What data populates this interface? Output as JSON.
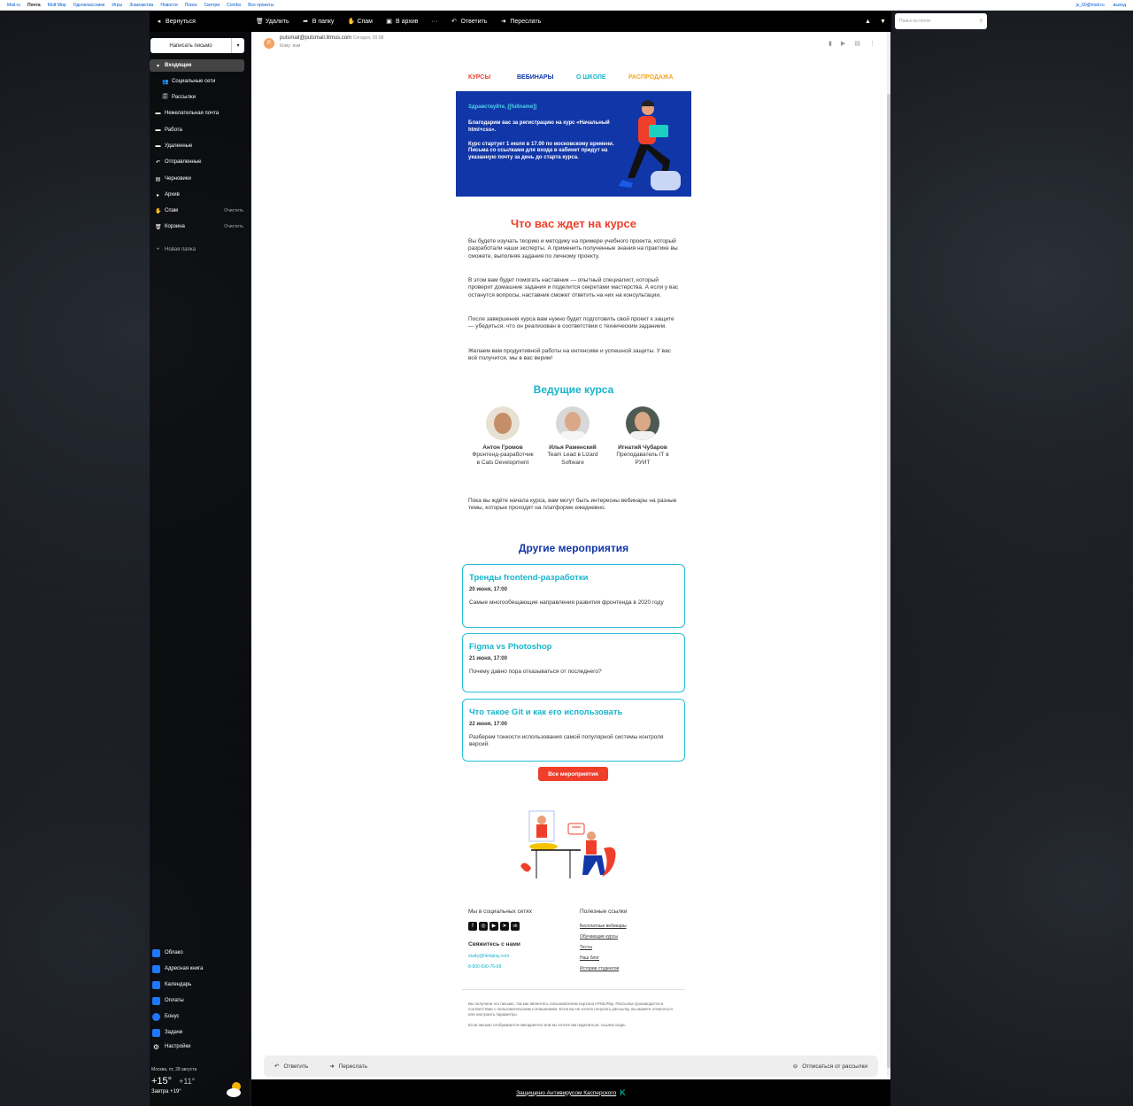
{
  "portal": {
    "links": [
      "Mail.ru",
      "Почта",
      "Мой Мир",
      "Одноклассники",
      "Игры",
      "Знакомства",
      "Новости",
      "Поиск",
      "Смотри",
      "Combo",
      "Все проекты"
    ],
    "user": "js_60@mail.ru",
    "logout": "выход"
  },
  "toolbar": {
    "back": "Вернуться",
    "delete": "Удалить",
    "to_folder": "В папку",
    "spam": "Спам",
    "archive": "В архив",
    "more": "···",
    "reply": "Ответить",
    "forward": "Переслать",
    "search_placeholder": "Поиск по почте"
  },
  "sidebar": {
    "compose": "Написать письмо",
    "folders": [
      {
        "label": "Входящие",
        "icon": "▾"
      },
      {
        "label": "Социальные сети",
        "icon": "👥"
      },
      {
        "label": "Рассылки",
        "icon": "🗐"
      },
      {
        "label": "Нежелательная почта",
        "icon": "▬"
      },
      {
        "label": "Работа",
        "icon": "▬"
      },
      {
        "label": "Удаленные",
        "icon": "▬"
      },
      {
        "label": "Отправленные",
        "icon": "↶"
      },
      {
        "label": "Черновики",
        "icon": "▤"
      },
      {
        "label": "Архив",
        "icon": "▸"
      },
      {
        "label": "Спам",
        "icon": "✋",
        "clear": "Очистить"
      },
      {
        "label": "Корзина",
        "icon": "🗑",
        "clear": "Очистить"
      }
    ],
    "new_folder": "Новая папка",
    "apps": [
      {
        "label": "Облако",
        "color": "#1e78ff"
      },
      {
        "label": "Адресная книга",
        "color": "#1e78ff"
      },
      {
        "label": "Календарь",
        "color": "#1e78ff"
      },
      {
        "label": "Оплаты",
        "color": "#1e78ff"
      },
      {
        "label": "Бонус",
        "color": "#1e78ff"
      },
      {
        "label": "Задачи",
        "color": "#1e78ff"
      },
      {
        "label": "Настройки",
        "color": "#333"
      }
    ],
    "weather": {
      "city": "Москва, пт, 28 августа",
      "temp": "+15°",
      "temp_night": "+11°",
      "tomorrow": "Завтра +19°"
    }
  },
  "message": {
    "avatar": "P",
    "sender": "putsmail@putsmail.litmus.com",
    "date": "Сегодня, 20:08",
    "to": "Кому: вам"
  },
  "email": {
    "nav": [
      "КУРСЫ",
      "ВЕБИНАРЫ",
      "О ШКОЛЕ",
      "РАСПРОДАЖА"
    ],
    "banner_hello": "Здравствуйте, [[fullname]]",
    "banner_p1": "Благодарим вас за регистрацию на курс «Начальный html+css».",
    "banner_p2": "Курс стартует 1 июля в 17.00 по московскому времени. Письма со ссылками для входа в кабинет придут на указанную почту за день до старта курса.",
    "section1_title": "Что вас ждет на курсе",
    "paragraphs": [
      "Вы будете изучать теорию и методику на примере учебного проекта, который разработали наши эксперты. А применить полученные знания на практике вы сможете, выполняя задания по личному проекту.",
      "В этом вам будет помогать наставник — опытный специалист, который проверит домашние задания и поделится секретами мастерства. А если у вас останутся вопросы, наставник сможет ответить на них на консультации.",
      "После завершения курса вам нужно будет подготовить свой проект к защите — убедиться, что он реализован в соответствии с техническим заданием.",
      "Желаем вам продуктивной работы на интенсиве и успешной защиты. У вас всё получится, мы в вас верим!"
    ],
    "section2_title": "Ведущие курса",
    "teachers": [
      {
        "name": "Антон Громов",
        "role": "Фронтенд-разработчик в Cats Development"
      },
      {
        "name": "Илья Раменский",
        "role": "Team Lead в Lizard Software"
      },
      {
        "name": "Игнатий Чубаров",
        "role": "Преподаватель IT в РУИТ"
      }
    ],
    "webinars_text": "Пока вы ждёте начала курса, вам могут быть интересны вебинары на разные темы, которые проходят на платформе ежедневно.",
    "section3_title": "Другие мероприятия",
    "events": [
      {
        "title": "Тренды frontend-разработки",
        "date": "20 июня, 17:00",
        "text": "Самые многообещающие направления развития фронтенда в 2020 году"
      },
      {
        "title": "Figma vs Photoshop",
        "date": "21 июня, 17:00",
        "text": "Почему давно пора отказываться от последнего?"
      },
      {
        "title": "Что такое Git и как его использовать",
        "date": "22 июня, 17:00",
        "text": "Разберем тонкости использования самой популярной системы контроля версий."
      }
    ],
    "all_events": "Все мероприятия",
    "social_title": "Мы в социальных сетях",
    "social_icons": [
      "f",
      "◎",
      "▶",
      "➤",
      "vk"
    ],
    "contact_title": "Свяжитесь с нами",
    "email": "study@htmlplay.com",
    "phone": "8-800-690-76-68",
    "links_title": "Полезные ссылки",
    "links": [
      "Бесплатные вебинары",
      "Обучающие курсы",
      "Тесты",
      "Наш блог",
      "Истории студентов"
    ],
    "legal1": "Вы получили это письмо, так как являетесь пользователем портала HTMLPlay. Рассылка производится в соответствии с пользовательским соглашением. Если вы не хотите получать рассылку, вы можете отписаться или настроить параметры.",
    "legal2": "Если письмо отображается некорректно или вы хотите им поделиться, ссылка сюда."
  },
  "bottom": {
    "reply": "Ответить",
    "forward": "Переслать",
    "unsubscribe": "Отписаться от рассылки"
  },
  "kaspersky": "Защищено Антивирусом Касперского",
  "colors": {
    "red": "#ef3f2b",
    "navy": "#1136a8",
    "teal": "#16b5cb",
    "orange": "#f5a623"
  }
}
